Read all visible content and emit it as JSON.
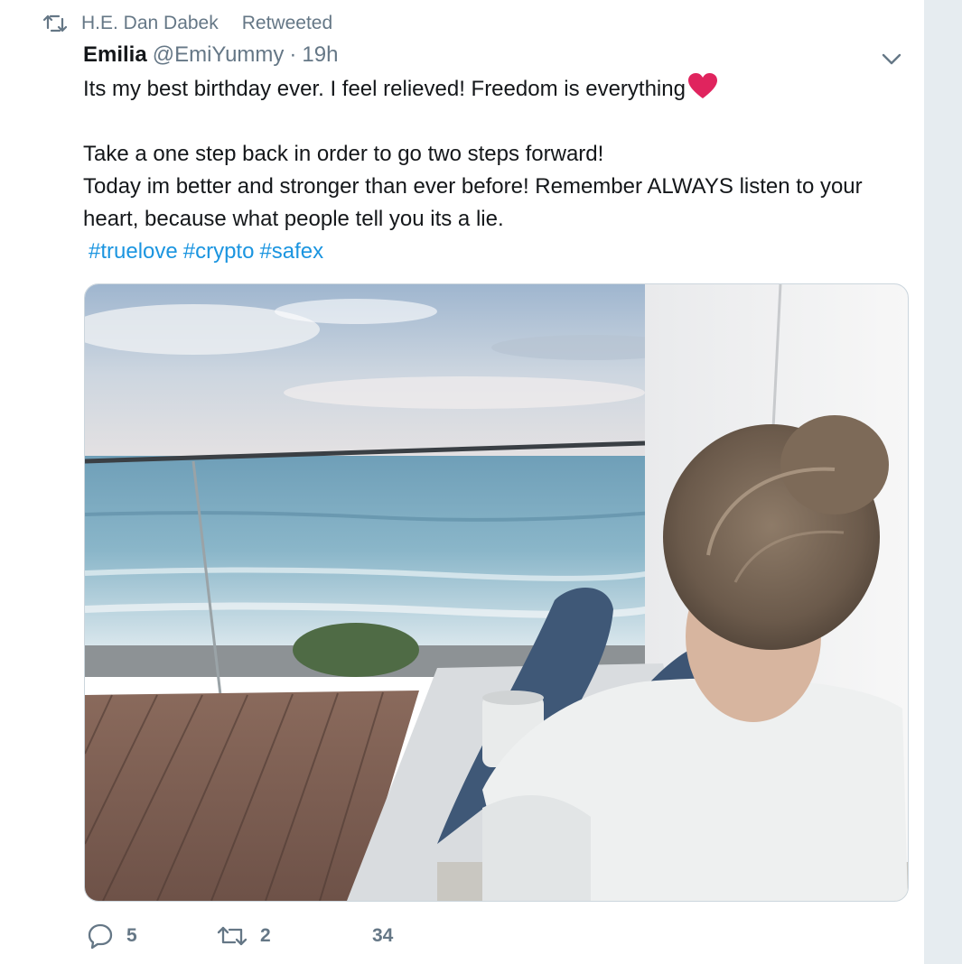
{
  "retweet_context": {
    "retweeter": "H.E. Dan Dabek",
    "label": "Retweeted"
  },
  "tweet": {
    "author_name": "Emilia",
    "author_handle": "@EmiYummy",
    "separator": "·",
    "timestamp": "19h",
    "lines": [
      "Its my best birthday ever. I feel relieved! Freedom is everything",
      "Take a one step back in order to go two steps forward!",
      "Today im better and stronger than ever before! Remember ALWAYS listen to your",
      "heart, because what people tell you its a lie."
    ],
    "emoji": "red-heart",
    "hashtags": [
      "#truelove",
      "#crypto",
      "#safex"
    ],
    "media": {
      "type": "photo",
      "scene": "woman on a balcony sofa with a mug, looking at the sea"
    }
  },
  "actions": {
    "reply_count": "5",
    "retweet_count": "2",
    "like_count": "34"
  },
  "icons": {
    "retweet": "retweet-icon",
    "caret": "chevron-down-icon",
    "reply": "reply-icon",
    "like": "heart-icon"
  },
  "colors": {
    "text": "#14171a",
    "secondary": "#657786",
    "link": "#1b95e0",
    "heart_emoji": "#e0245e",
    "rail": "#e6ecf0",
    "border": "#ccd6dd"
  }
}
